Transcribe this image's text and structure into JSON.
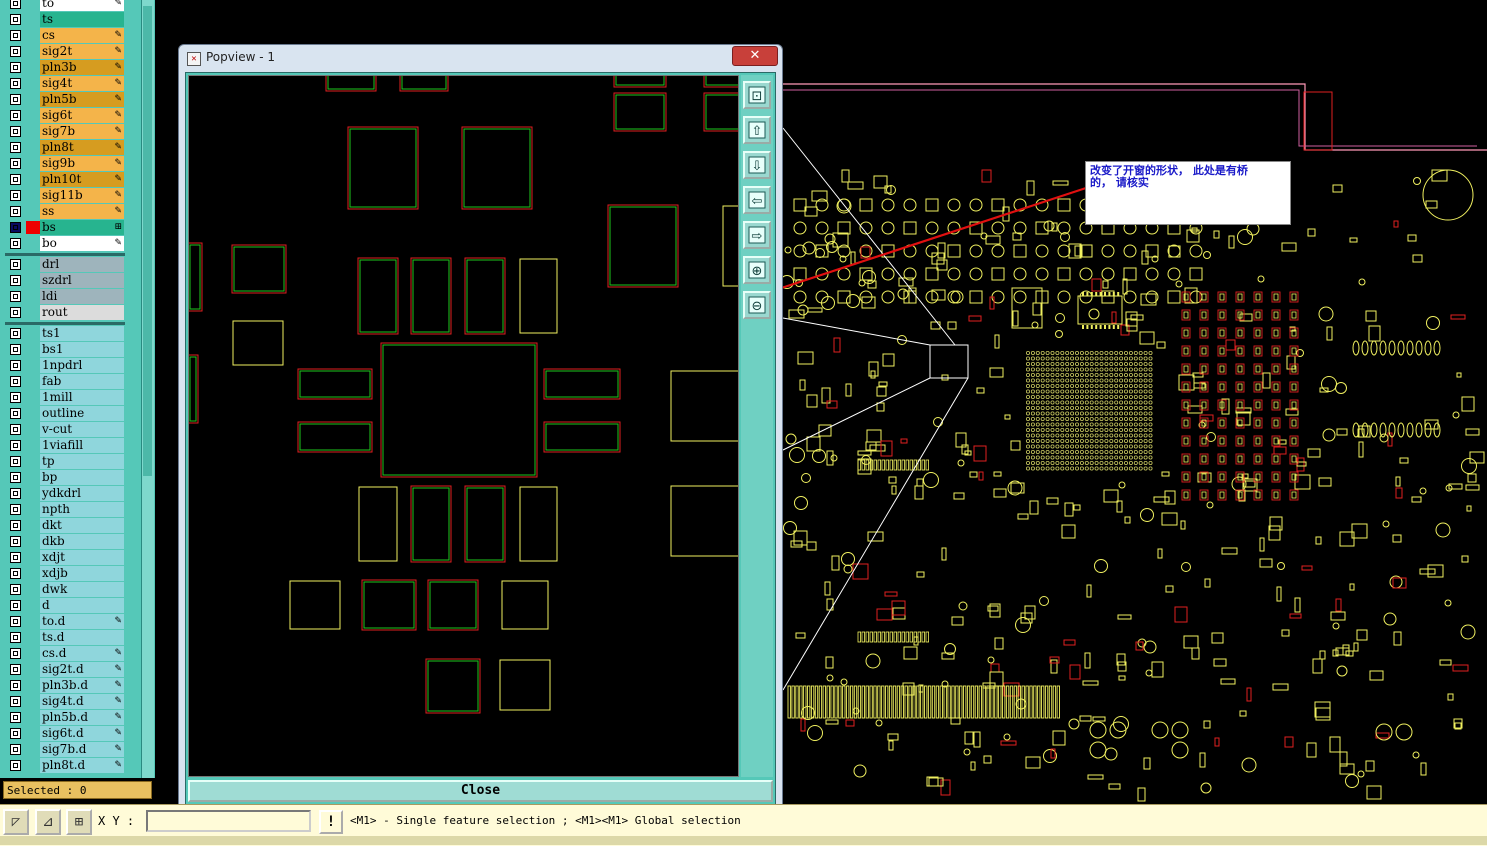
{
  "layers": [
    {
      "name": "to",
      "color": "#ffffff",
      "mark": "✎"
    },
    {
      "name": "ts",
      "color": "#27b48f",
      "mark": ""
    },
    {
      "name": "cs",
      "color": "#f4b44a",
      "mark": "✎"
    },
    {
      "name": "sig2t",
      "color": "#f4b44a",
      "mark": "✎"
    },
    {
      "name": "pln3b",
      "color": "#d69c20",
      "mark": "✎"
    },
    {
      "name": "sig4t",
      "color": "#f4b44a",
      "mark": "✎"
    },
    {
      "name": "pln5b",
      "color": "#d69c20",
      "mark": "✎"
    },
    {
      "name": "sig6t",
      "color": "#f4b44a",
      "mark": "✎"
    },
    {
      "name": "sig7b",
      "color": "#f4b44a",
      "mark": "✎"
    },
    {
      "name": "pln8t",
      "color": "#d69c20",
      "mark": "✎"
    },
    {
      "name": "sig9b",
      "color": "#f4b44a",
      "mark": "✎"
    },
    {
      "name": "pln10t",
      "color": "#d69c20",
      "mark": "✎"
    },
    {
      "name": "sig11b",
      "color": "#f4b44a",
      "mark": "✎"
    },
    {
      "name": "ss",
      "color": "#f4b44a",
      "mark": "✎"
    },
    {
      "name": "bs",
      "color": "#27b48f",
      "mark": "⊞",
      "active": true
    },
    {
      "name": "bo",
      "color": "#ffffff",
      "mark": "✎"
    },
    {
      "name": "drl",
      "color": "#9eb4bc",
      "mark": ""
    },
    {
      "name": "szdrl",
      "color": "#9eb4bc",
      "mark": ""
    },
    {
      "name": "ldi",
      "color": "#9eb4bc",
      "mark": ""
    },
    {
      "name": "rout",
      "color": "#dcdcdc",
      "mark": ""
    },
    {
      "name": "ts1",
      "color": "#8fd6dc",
      "mark": ""
    },
    {
      "name": "bs1",
      "color": "#8fd6dc",
      "mark": ""
    },
    {
      "name": "1npdrl",
      "color": "#8fd6dc",
      "mark": ""
    },
    {
      "name": "fab",
      "color": "#8fd6dc",
      "mark": ""
    },
    {
      "name": "1mill",
      "color": "#8fd6dc",
      "mark": ""
    },
    {
      "name": "outline",
      "color": "#8fd6dc",
      "mark": ""
    },
    {
      "name": "v-cut",
      "color": "#8fd6dc",
      "mark": ""
    },
    {
      "name": "1viafill",
      "color": "#8fd6dc",
      "mark": ""
    },
    {
      "name": "tp",
      "color": "#8fd6dc",
      "mark": ""
    },
    {
      "name": "bp",
      "color": "#8fd6dc",
      "mark": ""
    },
    {
      "name": "ydkdrl",
      "color": "#8fd6dc",
      "mark": ""
    },
    {
      "name": "npth",
      "color": "#8fd6dc",
      "mark": ""
    },
    {
      "name": "dkt",
      "color": "#8fd6dc",
      "mark": ""
    },
    {
      "name": "dkb",
      "color": "#8fd6dc",
      "mark": ""
    },
    {
      "name": "xdjt",
      "color": "#8fd6dc",
      "mark": ""
    },
    {
      "name": "xdjb",
      "color": "#8fd6dc",
      "mark": ""
    },
    {
      "name": "dwk",
      "color": "#8fd6dc",
      "mark": ""
    },
    {
      "name": "d",
      "color": "#8fd6dc",
      "mark": ""
    },
    {
      "name": "to.d",
      "color": "#8fd6dc",
      "mark": "✎"
    },
    {
      "name": "ts.d",
      "color": "#8fd6dc",
      "mark": ""
    },
    {
      "name": "cs.d",
      "color": "#8fd6dc",
      "mark": "✎"
    },
    {
      "name": "sig2t.d",
      "color": "#8fd6dc",
      "mark": "✎"
    },
    {
      "name": "pln3b.d",
      "color": "#8fd6dc",
      "mark": "✎"
    },
    {
      "name": "sig4t.d",
      "color": "#8fd6dc",
      "mark": "✎"
    },
    {
      "name": "pln5b.d",
      "color": "#8fd6dc",
      "mark": "✎"
    },
    {
      "name": "sig6t.d",
      "color": "#8fd6dc",
      "mark": "✎"
    },
    {
      "name": "sig7b.d",
      "color": "#8fd6dc",
      "mark": "✎"
    },
    {
      "name": "pln8t.d",
      "color": "#8fd6dc",
      "mark": "✎"
    }
  ],
  "status": {
    "selected": "Selected : 0"
  },
  "toolbar": {
    "xy_label": "X Y :",
    "xy_value": "",
    "hint_icon": "!",
    "hint": "<M1> - Single feature selection ; <M1><M1> Global selection"
  },
  "popview": {
    "title": "Popview - 1",
    "close_x": "✕",
    "close_label": "Close",
    "tools": [
      "zoom-fit-icon",
      "pan-up-icon",
      "pan-down-icon",
      "pan-left-icon",
      "pan-right-icon",
      "zoom-in-icon",
      "zoom-out-icon"
    ]
  },
  "annotation": {
    "line1": "改变了开窗的形状， 此处是有桥",
    "line2": "的， 请核实"
  },
  "colors": {
    "pad_green": "#1ec81e",
    "pad_red": "#e02020",
    "pad_yellow": "#f0f060",
    "arrow": "#e01010"
  }
}
